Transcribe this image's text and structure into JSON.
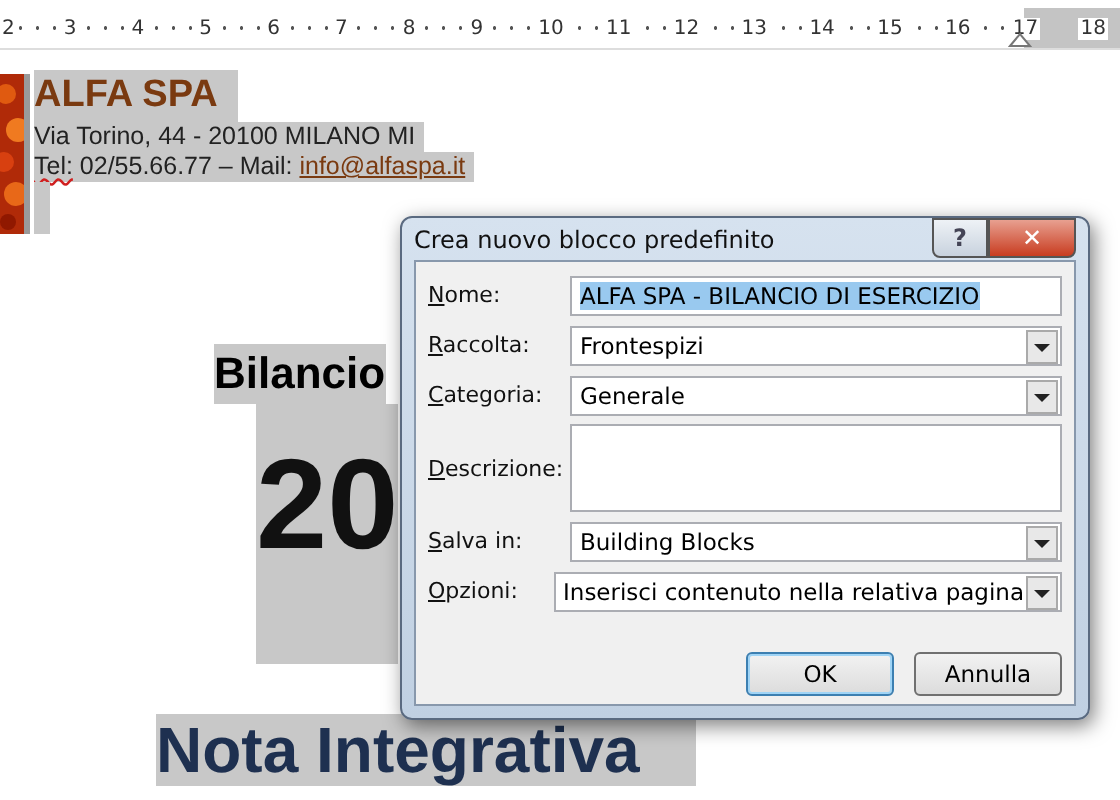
{
  "ruler": {
    "numbers": [
      "2",
      "3",
      "4",
      "5",
      "6",
      "7",
      "8",
      "9",
      "10",
      "11",
      "12",
      "13",
      "14",
      "15",
      "16",
      "17",
      "18"
    ]
  },
  "document": {
    "company": "ALFA SPA",
    "address": "Via Torino, 44 - 20100 MILANO MI",
    "contact_prefix": "Tel:",
    "contact_text": " 02/55.66.77 – Mail: ",
    "email": "info@alfaspa.it",
    "heading": "Bilancio",
    "year": "20",
    "subtitle": "Nota Integrativa"
  },
  "dialog": {
    "title": "Crea nuovo blocco predefinito",
    "help": "?",
    "close": "✕",
    "fields": [
      {
        "kind": "text",
        "label": "Nome:",
        "value": "ALFA SPA - BILANCIO DI ESERCIZIO",
        "text_selected": true
      },
      {
        "kind": "dropdown",
        "label": "Raccolta:",
        "value": "Frontespizi"
      },
      {
        "kind": "dropdown",
        "label": "Categoria:",
        "value": "Generale"
      },
      {
        "kind": "textarea",
        "label": "Descrizione:"
      },
      {
        "kind": "dropdown",
        "label": "Salva in:",
        "value": "Building Blocks"
      },
      {
        "kind": "dropdown",
        "label": "Opzioni:",
        "value": "Inserisci contenuto nella relativa pagina"
      }
    ],
    "buttons": [
      {
        "label": "OK",
        "default": true
      },
      {
        "label": "Annulla",
        "default": false
      }
    ]
  }
}
